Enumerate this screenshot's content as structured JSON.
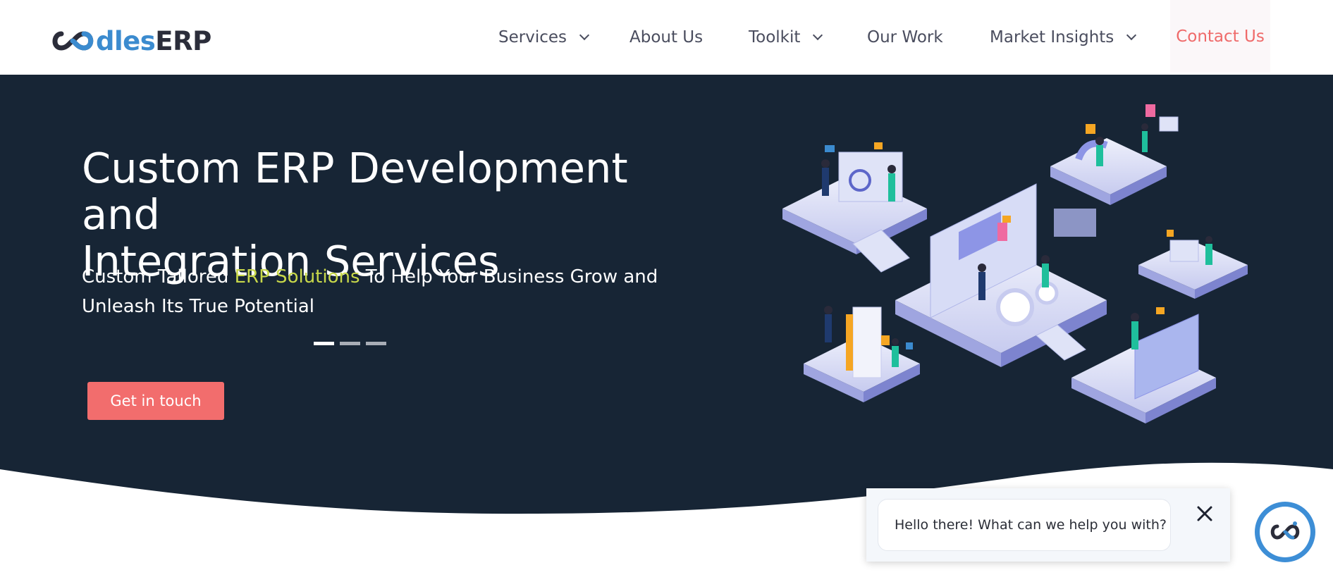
{
  "brand": {
    "logo_text_blue": "dles",
    "logo_text_dark": "ERP"
  },
  "nav": {
    "items": [
      {
        "label": "Services",
        "has_dropdown": true
      },
      {
        "label": "About Us",
        "has_dropdown": false
      },
      {
        "label": "Toolkit",
        "has_dropdown": true
      },
      {
        "label": "Our Work",
        "has_dropdown": false
      },
      {
        "label": "Market Insights",
        "has_dropdown": true
      }
    ],
    "contact_label": "Contact Us"
  },
  "hero": {
    "title_line1": "Custom ERP Development and",
    "title_line2": "Integration Services",
    "subtitle_pre": "Custom Tailored ",
    "subtitle_highlight": "ERP Solutions",
    "subtitle_post": " To Help Your Business Grow and Unleash Its True Potential",
    "cta_label": "Get in touch",
    "slides_count": 3,
    "active_slide": 1
  },
  "chat": {
    "message": "Hello there! What can we help you with?",
    "close_icon": "close-icon",
    "launcher_icon": "chat-launcher-icon"
  },
  "colors": {
    "hero_bg": "#172535",
    "accent_red": "#f26d6d",
    "highlight_yellow": "#c8d84a",
    "logo_blue": "#3b8bcf",
    "chat_blue": "#3d8ed6"
  }
}
